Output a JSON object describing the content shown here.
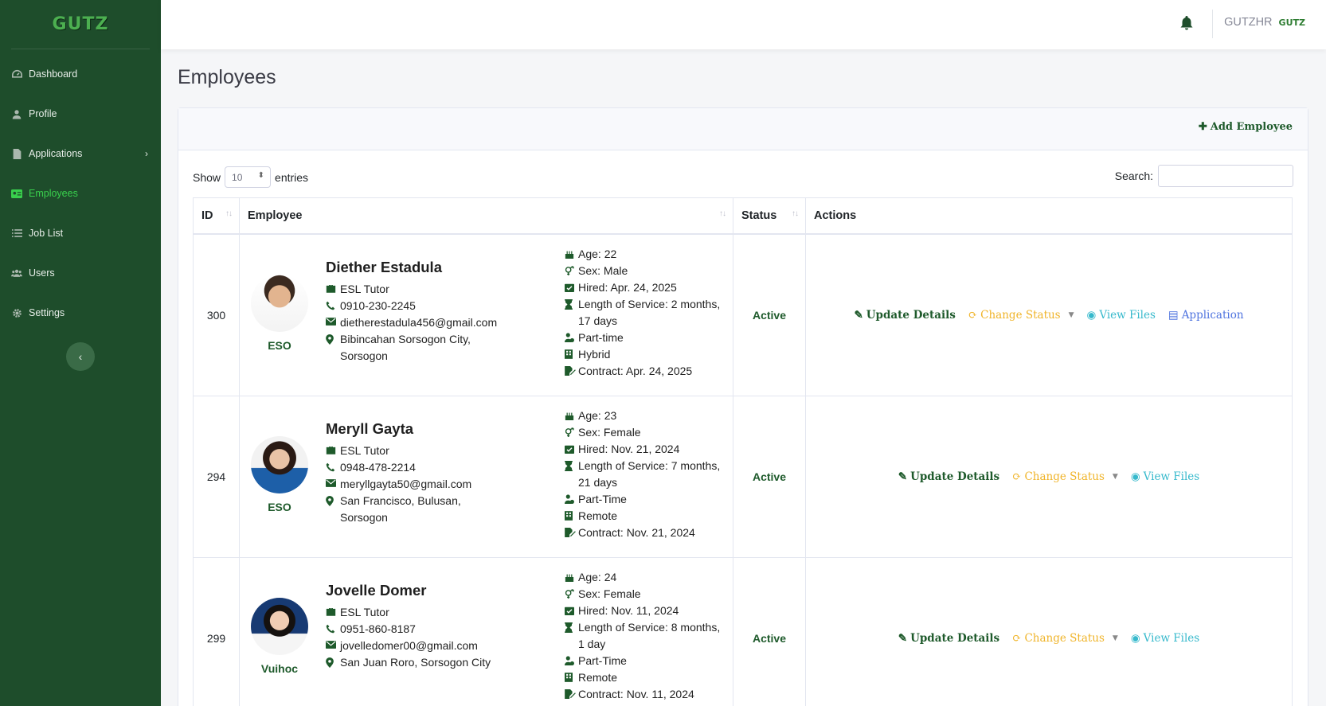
{
  "sidebar": {
    "logo_text": "GUTZ",
    "items": [
      {
        "label": "Dashboard",
        "icon": "dashboard-icon"
      },
      {
        "label": "Profile",
        "icon": "user-icon"
      },
      {
        "label": "Applications",
        "icon": "file-icon"
      },
      {
        "label": "Employees",
        "icon": "id-card-icon",
        "active": true
      },
      {
        "label": "Job List",
        "icon": "list-icon"
      },
      {
        "label": "Users",
        "icon": "users-icon"
      },
      {
        "label": "Settings",
        "icon": "gear-icon"
      }
    ]
  },
  "topbar": {
    "username": "GUTZHR",
    "user_logo": "GUTZ"
  },
  "page": {
    "title": "Employees"
  },
  "card": {
    "add_label": "Add Employee"
  },
  "table_controls": {
    "show_label": "Show",
    "entries_value": "10",
    "entries_label": "entries",
    "search_label": "Search:"
  },
  "columns": [
    "ID",
    "Employee",
    "Status",
    "Actions"
  ],
  "actions": {
    "update": "Update Details",
    "change_status": "Change Status",
    "view_files": "View Files",
    "application": "Application"
  },
  "rows": [
    {
      "id": "300",
      "avatar_label": "ESO",
      "name": "Diether Estadula",
      "position": "ESL Tutor",
      "phone": "0910-230-2245",
      "email": "dietherestadula456@gmail.com",
      "address": "Bibincahan Sorsogon City, Sorsogon",
      "age": "Age: 22",
      "sex": "Sex: Male",
      "hired": "Hired: Apr. 24, 2025",
      "service": "Length of Service: 2 months, 17 days",
      "type": "Part-time",
      "setup": "Hybrid",
      "contract": "Contract: Apr. 24, 2025",
      "status": "Active"
    },
    {
      "id": "294",
      "avatar_label": "ESO",
      "name": "Meryll Gayta",
      "position": "ESL Tutor",
      "phone": "0948-478-2214",
      "email": "meryllgayta50@gmail.com",
      "address": "San Francisco, Bulusan, Sorsogon",
      "age": "Age: 23",
      "sex": "Sex: Female",
      "hired": "Hired: Nov. 21, 2024",
      "service": "Length of Service: 7 months, 21 days",
      "type": "Part-Time",
      "setup": "Remote",
      "contract": "Contract: Nov. 21, 2024",
      "status": "Active"
    },
    {
      "id": "299",
      "avatar_label": "Vuihoc",
      "name": "Jovelle Domer",
      "position": "ESL Tutor",
      "phone": "0951-860-8187",
      "email": "jovelledomer00@gmail.com",
      "address": "San Juan Roro, Sorsogon City",
      "age": "Age: 24",
      "sex": "Sex: Female",
      "hired": "Hired: Nov. 11, 2024",
      "service": "Length of Service: 8 months, 1 day",
      "type": "Part-Time",
      "setup": "Remote",
      "contract": "Contract: Nov. 11, 2024",
      "status": "Active"
    }
  ]
}
